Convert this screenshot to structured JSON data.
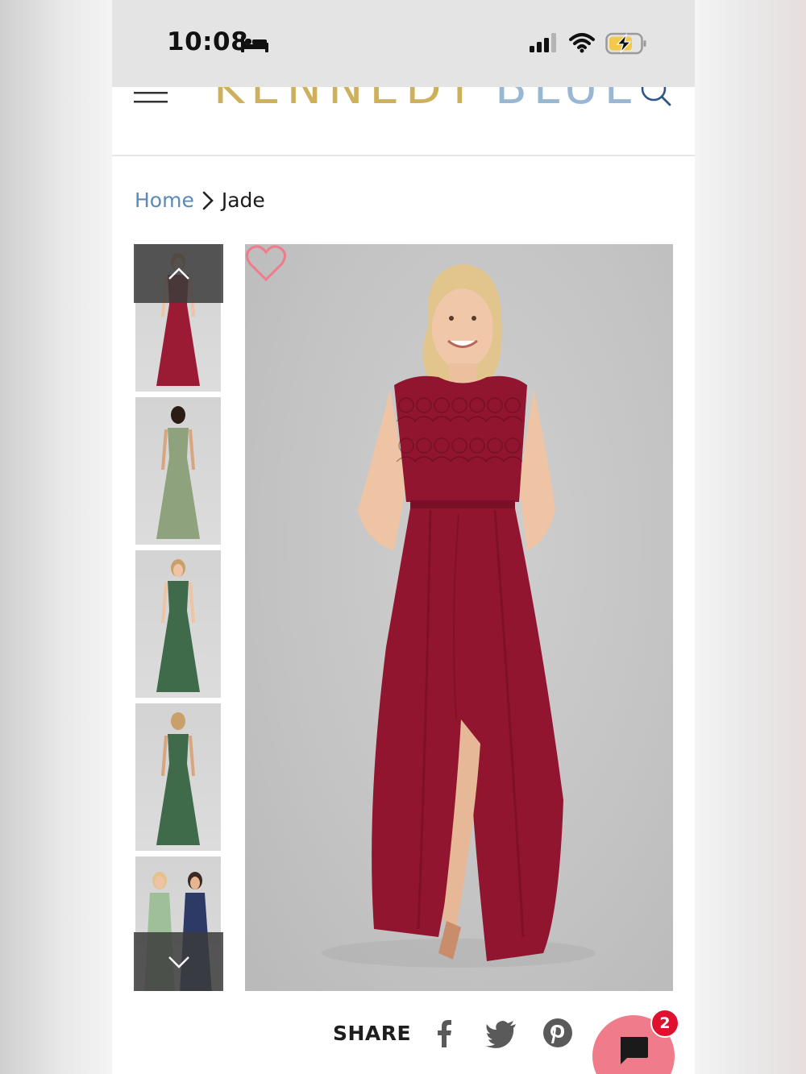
{
  "status_bar": {
    "time": "10:08",
    "icons": [
      "sleep-focus-icon",
      "cellular-signal-icon",
      "wifi-icon",
      "battery-charging-icon"
    ]
  },
  "header": {
    "brand_part1": "KENNEDY",
    "brand_part2": "BLUE",
    "brand_colors": {
      "kennedy": "#c9a74a",
      "blue": "#8fb0cf"
    },
    "icons": [
      "menu-icon",
      "search-icon"
    ]
  },
  "breadcrumb": {
    "home": "Home",
    "current": "Jade"
  },
  "gallery": {
    "thumbnails": [
      {
        "dress_color": "#9b1b34",
        "view": "front"
      },
      {
        "dress_color": "#8ea37d",
        "view": "back"
      },
      {
        "dress_color": "#3f6b4a",
        "view": "front"
      },
      {
        "dress_color": "#3f6b4a",
        "view": "back"
      },
      {
        "dress_color": "#2d3a66",
        "view": "group"
      }
    ],
    "main_dress_color": "#92152f",
    "icons": [
      "chevron-up-icon",
      "chevron-down-icon",
      "heart-icon"
    ]
  },
  "share": {
    "label": "SHARE",
    "icons": [
      "facebook-icon",
      "twitter-icon",
      "pinterest-icon"
    ]
  },
  "chat": {
    "badge_count": "2",
    "colors": {
      "button": "#f07b8a",
      "badge": "#e0102f"
    }
  }
}
